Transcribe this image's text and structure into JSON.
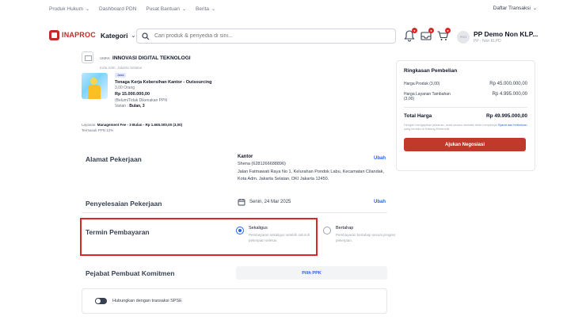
{
  "topnav": {
    "items": [
      "Produk Hukum",
      "Dashboard PDN",
      "Pusat Bantuan",
      "Berita"
    ],
    "right": "Daftar Transaksi"
  },
  "header": {
    "logo_text": "INAPROC",
    "kategori_label": "Kategori",
    "search_placeholder": "Cari produk & penyedia di sini...",
    "avatar_text": "PDN",
    "user_name": "PP Demo Non KLP...",
    "user_sub": "PP - Non KLPD"
  },
  "vendor": {
    "tag": "UMKK",
    "name": "INNOVASI DIGITAL TEKNOLOGI",
    "location": "Kota Adm. Jakarta Selatan"
  },
  "product": {
    "chip": "Jasa",
    "name": "Tenaga Kerja Kebersihan Kantor - Outsourcing",
    "qty": "3,00 Orang",
    "price": "Rp 15.000.000,00",
    "tax_note": "(Belum/Tidak Dikenakan PPN",
    "variant_label": "Varian",
    "variant_value": "Bulan, 3"
  },
  "layanan": {
    "label": "Layanan",
    "value": "Management Fee - 3 Bulan - Rp 1.665.000,00 (3,00)",
    "note": "Termasuk PPN 12%"
  },
  "summary": {
    "title": "Ringkasan Pembelian",
    "harga_produk_label": "Harga Produk (3,00)",
    "harga_produk_value": "Rp 45.000.000,00",
    "harga_layanan_label": "Harga Layanan Tambahan (3,00)",
    "harga_layanan_value": "Rp 4.995.000,00",
    "total_label": "Total Harga",
    "total_value": "Rp 49.995.000,00",
    "note_prefix": "Dengan mengajukan pesanan, anda secara otomatis telah menyetujui",
    "note_link": "Syarat dan Ketentuan",
    "note_suffix": "yang berlaku di Katalog Elektronik",
    "cta": "Ajukan Negosiasi"
  },
  "alamat": {
    "title": "Alamat Pekerjaan",
    "ubah": "Ubah",
    "name": "Kantor",
    "contact": "Shena (6281266688896)",
    "address": "Jalan Fatmawati Raya No 1, Kelurahan Pondok Labu, Kecamatan Cilandak, Kota Adm. Jakarta Selatan, DKI Jakarta 12450."
  },
  "penyelesaian": {
    "title": "Penyelesaian Pekerjaan",
    "ubah": "Ubah",
    "date": "Senin, 24 Mar 2025"
  },
  "termin": {
    "title": "Termin Pembayaran",
    "opt1_label": "Sekaligus",
    "opt1_desc": "Pembayaran sekaligus setelah seluruh pekerjaan selesai.",
    "opt2_label": "Bertahap",
    "opt2_desc": "Pembayaran bertahap sesuai progres pekerjaan."
  },
  "ppk": {
    "title": "Pejabat Pembuat Komitmen",
    "button": "Pilih PPK"
  },
  "spse": {
    "label": "Hubungkan dengan transaksi SPSE"
  }
}
